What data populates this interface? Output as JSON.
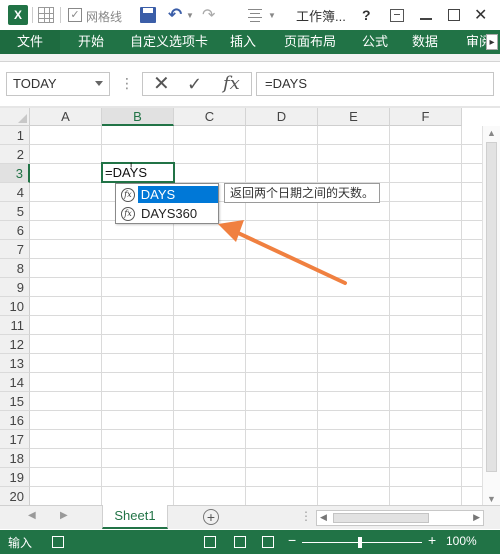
{
  "titlebar": {
    "app_icon": "X",
    "gridlines_label": "网格线",
    "gridlines_checked": true,
    "doc_title": "工作簿...",
    "help": "?",
    "minimize": "",
    "close": "✕"
  },
  "ribbon": {
    "tabs": [
      "文件",
      "开始",
      "自定义选项卡",
      "插入",
      "页面布局",
      "公式",
      "数据",
      "审阅"
    ]
  },
  "formula_bar": {
    "name_box": "TODAY",
    "cancel": "✕",
    "enter": "✓",
    "fx": "fx",
    "formula": "=DAYS"
  },
  "grid": {
    "columns": [
      "A",
      "B",
      "C",
      "D",
      "E",
      "F"
    ],
    "selected_column": "B",
    "rows": [
      "1",
      "2",
      "3",
      "4",
      "5",
      "6",
      "7",
      "8",
      "9",
      "10",
      "11",
      "12",
      "13",
      "14",
      "15",
      "16",
      "17",
      "18",
      "19",
      "20"
    ],
    "selected_row": "3",
    "active_cell_text": "=DAYS"
  },
  "autocomplete": {
    "items": [
      "DAYS",
      "DAYS360"
    ],
    "selected_index": 0,
    "tooltip": "返回两个日期之间的天数。"
  },
  "annotation": {
    "arrow_color": "#f08040"
  },
  "sheets": {
    "tabs": [
      "Sheet1"
    ],
    "add": "+"
  },
  "statusbar": {
    "mode": "输入",
    "zoom": "100%",
    "zoom_percent": 100
  },
  "colors": {
    "accent": "#217346",
    "selection": "#0078d7"
  }
}
